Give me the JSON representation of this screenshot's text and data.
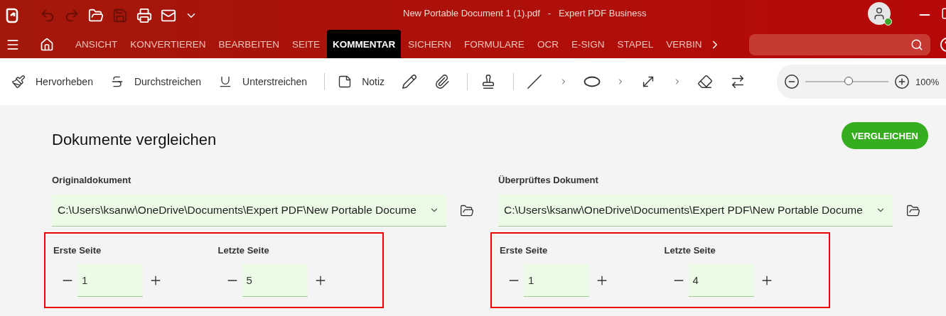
{
  "window": {
    "title": "New Portable Document 1 (1).pdf   -   Expert PDF Business"
  },
  "quick_access": [
    {
      "kind": "undo",
      "disabled": true
    },
    {
      "kind": "redo",
      "disabled": true
    },
    {
      "kind": "open",
      "disabled": false
    },
    {
      "kind": "save",
      "disabled": true
    },
    {
      "kind": "print",
      "disabled": false
    },
    {
      "kind": "mail",
      "disabled": false
    },
    {
      "kind": "more",
      "disabled": false
    }
  ],
  "ribbon_tabs": [
    {
      "label": "ANSICHT",
      "selected": false
    },
    {
      "label": "KONVERTIEREN",
      "selected": false
    },
    {
      "label": "BEARBEITEN",
      "selected": false
    },
    {
      "label": "SEITE",
      "selected": false
    },
    {
      "label": "KOMMENTAR",
      "selected": true
    },
    {
      "label": "SICHERN",
      "selected": false
    },
    {
      "label": "FORMULARE",
      "selected": false
    },
    {
      "label": "OCR",
      "selected": false
    },
    {
      "label": "E-SIGN",
      "selected": false
    },
    {
      "label": "STAPEL",
      "selected": false
    },
    {
      "label": "VERBIN",
      "selected": false
    }
  ],
  "tools": [
    {
      "kind": "highlight",
      "label": "Hervorheben"
    },
    {
      "kind": "strike",
      "label": "Durchstreichen"
    },
    {
      "kind": "underline",
      "label": "Unterstreichen"
    },
    {
      "kind": "separator"
    },
    {
      "kind": "note",
      "label": "Notiz"
    },
    {
      "kind": "pencil"
    },
    {
      "kind": "attach"
    },
    {
      "kind": "separator"
    },
    {
      "kind": "stamp"
    },
    {
      "kind": "separator"
    },
    {
      "kind": "line"
    },
    {
      "kind": "more"
    },
    {
      "kind": "ellipse"
    },
    {
      "kind": "more"
    },
    {
      "kind": "measure"
    },
    {
      "kind": "more"
    },
    {
      "kind": "eraser"
    },
    {
      "kind": "compare"
    }
  ],
  "zoom": {
    "level": 0.52,
    "reading": "100%"
  },
  "compare": {
    "title": "Dokumente vergleichen",
    "button": "VERGLEICHEN",
    "documents": [
      {
        "label": "Originaldokument",
        "path": "C:\\Users\\ksanw\\OneDrive\\Documents\\Expert PDF\\New Portable Docume",
        "range": {
          "highlighted": true,
          "first_label": "Erste Seite",
          "first_value": "1",
          "last_label": "Letzte Seite",
          "last_value": "5"
        }
      },
      {
        "label": "Überprüftes Dokument",
        "path": "C:\\Users\\ksanw\\OneDrive\\Documents\\Expert PDF\\New Portable Docume",
        "range": {
          "highlighted": true,
          "first_label": "Erste Seite",
          "first_value": "1",
          "last_label": "Letzte Seite",
          "last_value": "4"
        }
      }
    ]
  }
}
